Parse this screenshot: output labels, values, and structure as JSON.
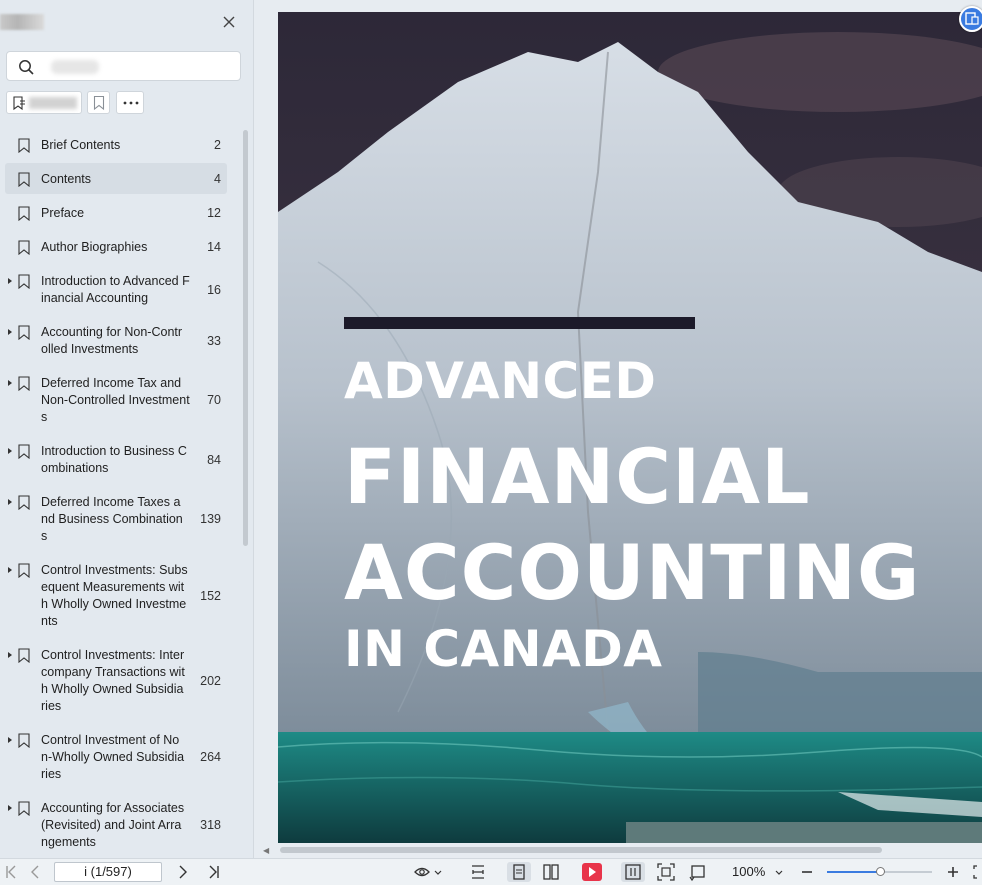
{
  "sidebar": {
    "search": {
      "placeholder": "",
      "value": ""
    },
    "outline": [
      {
        "label": "Brief Contents",
        "page": "2",
        "expandable": false,
        "selected": false
      },
      {
        "label": "Contents",
        "page": "4",
        "expandable": false,
        "selected": true
      },
      {
        "label": "Preface",
        "page": "12",
        "expandable": false,
        "selected": false
      },
      {
        "label": "Author Biographies",
        "page": "14",
        "expandable": false,
        "selected": false
      },
      {
        "label": "Introduction to Advanced F\ninancial Accounting",
        "page": "16",
        "expandable": true,
        "selected": false
      },
      {
        "label": "Accounting for Non-Contr\nolled Investments",
        "page": "33",
        "expandable": true,
        "selected": false
      },
      {
        "label": "Deferred Income Tax and\nNon-Controlled Investment\ns",
        "page": "70",
        "expandable": true,
        "selected": false
      },
      {
        "label": "Introduction to Business C\nombinations",
        "page": "84",
        "expandable": true,
        "selected": false
      },
      {
        "label": "Deferred Income Taxes a\nnd Business Combination\ns",
        "page": "139",
        "expandable": true,
        "selected": false
      },
      {
        "label": "Control Investments: Subs\nequent Measurements wit\nh Wholly Owned Investme\nnts",
        "page": "152",
        "expandable": true,
        "selected": false
      },
      {
        "label": "Control Investments: Inter\ncompany Transactions wit\nh Wholly Owned Subsidia\nries",
        "page": "202",
        "expandable": true,
        "selected": false
      },
      {
        "label": "Control Investment of No\nn-Wholly Owned Subsidia\nries",
        "page": "264",
        "expandable": true,
        "selected": false
      },
      {
        "label": "Accounting for Associates\n(Revisited) and Joint Arra\nngements",
        "page": "318",
        "expandable": true,
        "selected": false
      }
    ]
  },
  "cover": {
    "line1": "ADVANCED",
    "line2": "FINANCIAL",
    "line3": "ACCOUNTING",
    "line4": "IN CANADA"
  },
  "toolbar": {
    "page_indicator": "i (1/597)",
    "zoom": "100%",
    "zoom_level": 0.5
  },
  "colors": {
    "accent": "#3a7be0",
    "play_button": "#e8344a",
    "sidebar_bg": "#e3e9ef"
  }
}
